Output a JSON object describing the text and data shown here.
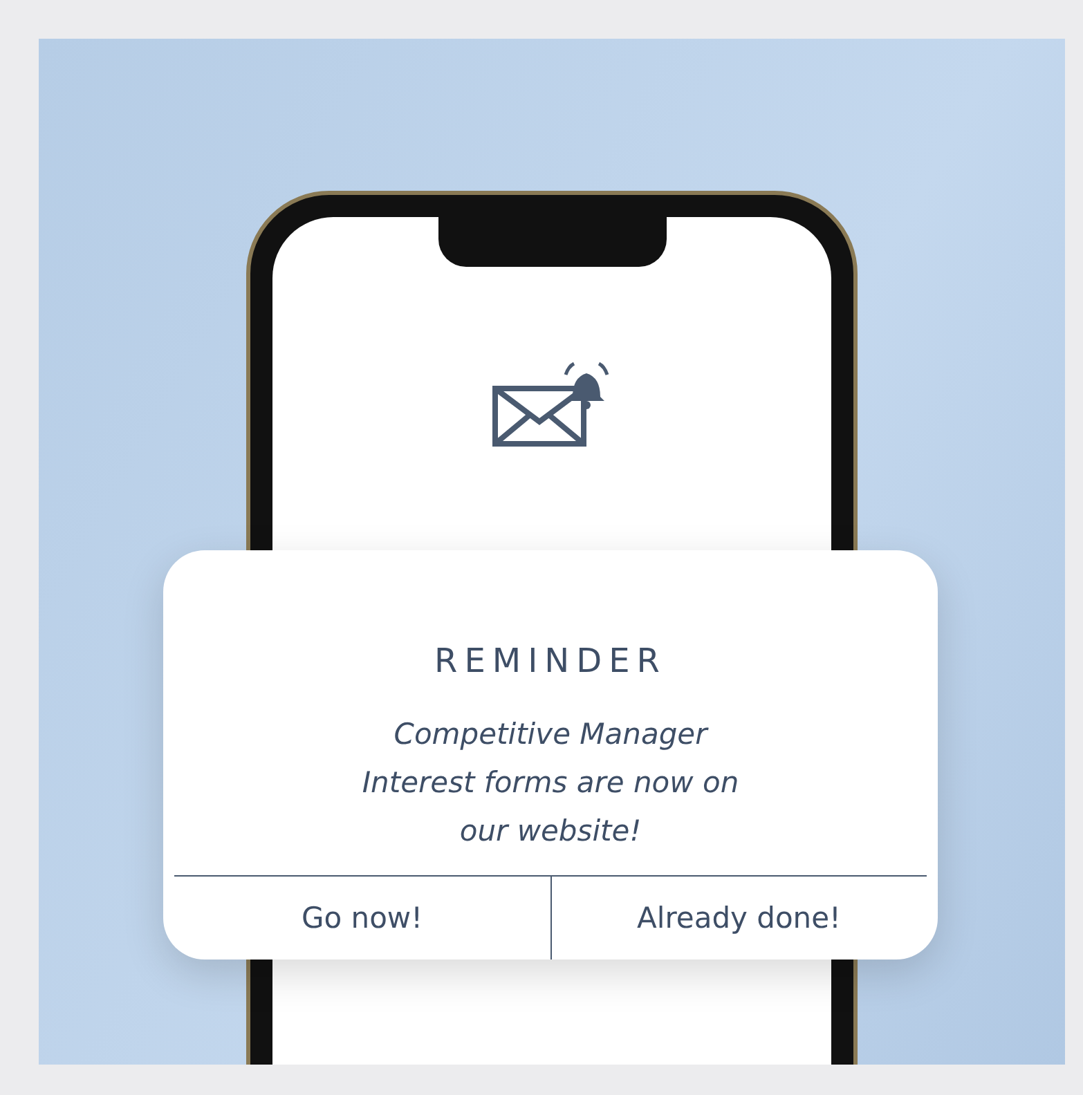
{
  "notification": {
    "title": "REMINDER",
    "message_lines": [
      "Competitive Manager",
      "Interest forms are now on",
      "our website!"
    ],
    "actions": [
      "Go now!",
      "Already done!"
    ]
  }
}
